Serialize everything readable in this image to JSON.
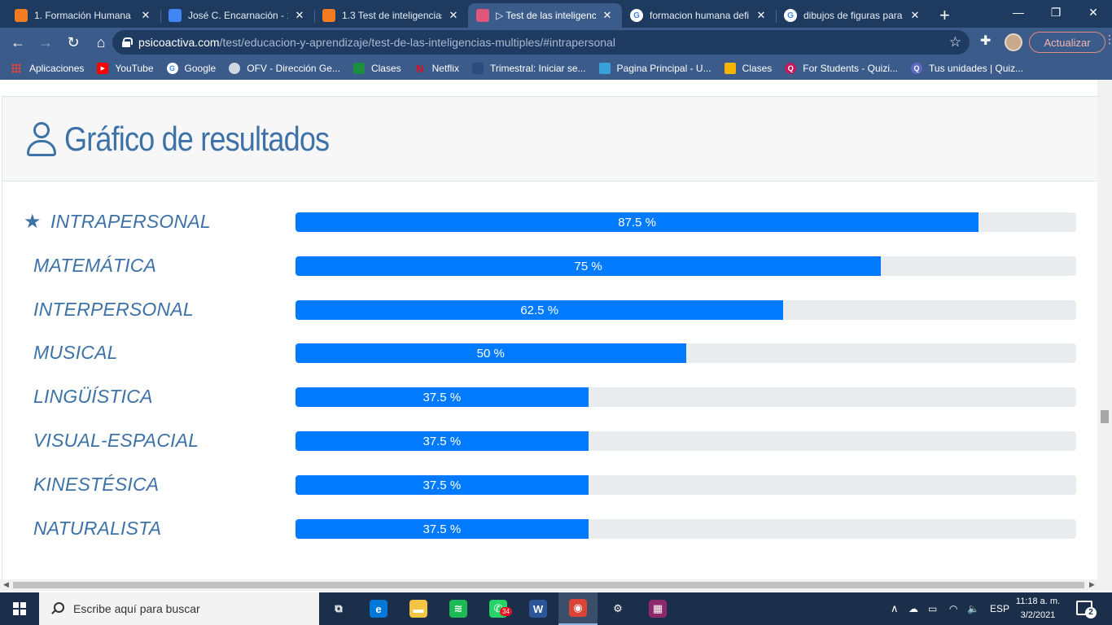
{
  "browser": {
    "tabs": [
      {
        "title": "1. Formación Humana",
        "icon": "moodle-icon",
        "color": "#f37b20",
        "active": false
      },
      {
        "title": "José C. Encarnación - 1.",
        "icon": "docs-icon",
        "color": "#4285f4",
        "active": false
      },
      {
        "title": "1.3 Test de inteligencias",
        "icon": "moodle-icon",
        "color": "#f37b20",
        "active": false
      },
      {
        "title": "▷ Test de las inteligenc",
        "icon": "psicoactiva-icon",
        "color": "#e0567a",
        "active": true
      },
      {
        "title": "formacion humana defi",
        "icon": "google-icon",
        "color": "#ffffff",
        "active": false
      },
      {
        "title": "dibujos de figuras para",
        "icon": "google-icon",
        "color": "#ffffff",
        "active": false
      }
    ],
    "new_tab": "+",
    "window_controls": {
      "minimize": "—",
      "maximize": "❐",
      "close": "✕"
    },
    "url": {
      "host": "psicoactiva.com",
      "path": "/test/educacion-y-aprendizaje/test-de-las-inteligencias-multiples/#intrapersonal"
    },
    "update_label": "Actualizar",
    "bookmarks": [
      {
        "label": "Aplicaciones",
        "icon": "apps-icon",
        "color": "#ea4335"
      },
      {
        "label": "YouTube",
        "icon": "youtube-icon",
        "color": "#ff0000"
      },
      {
        "label": "Google",
        "icon": "google-icon",
        "color": "#ffffff"
      },
      {
        "label": "OFV - Dirección Ge...",
        "icon": "globe-icon",
        "color": "#cfd8e3"
      },
      {
        "label": "Clases",
        "icon": "classroom-icon",
        "color": "#1e8e3e"
      },
      {
        "label": "Netflix",
        "icon": "netflix-icon",
        "color": "#e50914"
      },
      {
        "label": "Trimestral: Iniciar se...",
        "icon": "site-icon",
        "color": "#2b4c7e"
      },
      {
        "label": "Pagina Principal - U...",
        "icon": "site-icon",
        "color": "#3aa0d8"
      },
      {
        "label": "Clases",
        "icon": "classroom-icon",
        "color": "#f4b400"
      },
      {
        "label": "For Students - Quizi...",
        "icon": "quizizz-icon",
        "color": "#c2185b"
      },
      {
        "label": "Tus unidades | Quiz...",
        "icon": "quizizz-icon",
        "color": "#5c6bc0"
      }
    ]
  },
  "page": {
    "card_title": "Gráfico de resultados",
    "results": [
      {
        "label": "INTRAPERSONAL",
        "value": 87.5,
        "text": "87.5 %",
        "top": true
      },
      {
        "label": "MATEMÁTICA",
        "value": 75,
        "text": "75 %",
        "top": false
      },
      {
        "label": "INTERPERSONAL",
        "value": 62.5,
        "text": "62.5 %",
        "top": false
      },
      {
        "label": "MUSICAL",
        "value": 50,
        "text": "50 %",
        "top": false
      },
      {
        "label": "LINGÜÍSTICA",
        "value": 37.5,
        "text": "37.5 %",
        "top": false
      },
      {
        "label": "VISUAL-ESPACIAL",
        "value": 37.5,
        "text": "37.5 %",
        "top": false
      },
      {
        "label": "KINESTÉSICA",
        "value": 37.5,
        "text": "37.5 %",
        "top": false
      },
      {
        "label": "NATURALISTA",
        "value": 37.5,
        "text": "37.5 %",
        "top": false
      }
    ],
    "colors": {
      "accent": "#3d72a8",
      "bar": "#007bff",
      "track": "#e9ecef"
    }
  },
  "taskbar": {
    "search_placeholder": "Escribe aquí para buscar",
    "apps": [
      {
        "name": "task-view-icon",
        "glyph": "⧉",
        "color": "#1b2f4a"
      },
      {
        "name": "edge-icon",
        "glyph": "e",
        "color": "#0078d7"
      },
      {
        "name": "file-explorer-icon",
        "glyph": "▬",
        "color": "#f4c542"
      },
      {
        "name": "spotify-icon",
        "glyph": "≋",
        "color": "#1db954"
      },
      {
        "name": "whatsapp-icon",
        "glyph": "✆",
        "color": "#25d366",
        "badge": "34"
      },
      {
        "name": "word-icon",
        "glyph": "W",
        "color": "#2b579a"
      },
      {
        "name": "chrome-icon",
        "glyph": "◉",
        "color": "#db4437",
        "active": true
      },
      {
        "name": "settings-icon",
        "glyph": "⚙",
        "color": "#1b2f4a"
      },
      {
        "name": "winrar-icon",
        "glyph": "▦",
        "color": "#8e2a6b"
      }
    ],
    "language": "ESP",
    "time": "11:18 a. m.",
    "date": "3/2/2021",
    "notifications": "2"
  }
}
